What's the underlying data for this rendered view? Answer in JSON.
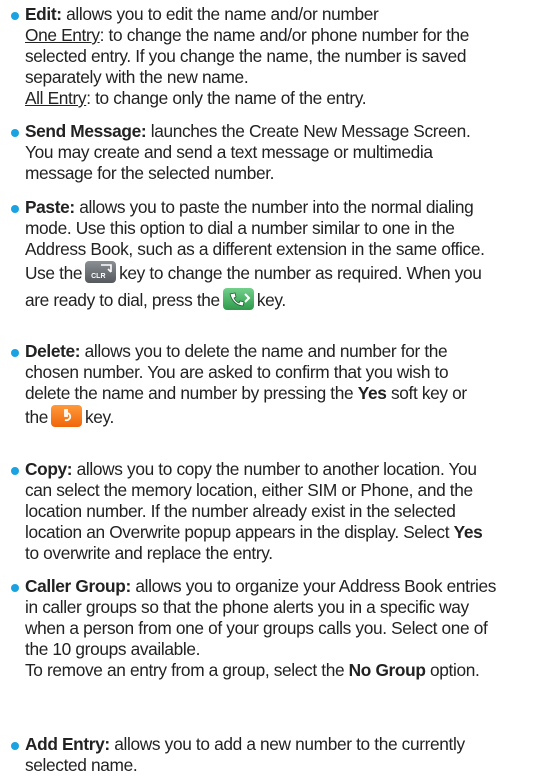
{
  "items": [
    {
      "title": "Edit:",
      "lines": [
        "allows you to edit the name and/or number",
        [
          "One Entry",
          ": to change the name and/or phone number for the"
        ],
        "selected entry. If you change the name, the number is saved",
        "separately with the new name.",
        [
          "All Entry",
          ": to change only the name of the entry."
        ]
      ]
    },
    {
      "title": "Send Message:",
      "lines": [
        "launches the Create New Message Screen.",
        "You may create and send a text message or multimedia",
        "message for the selected number."
      ]
    },
    {
      "title": "Paste:",
      "lines": [
        "allows you to paste the number into the normal dialing",
        "mode. Use this option to dial a number similar to one in the",
        "Address Book, such as a different extension in the same office.",
        [
          "Use the",
          "key to change the number as required. When you"
        ],
        [
          "are ready to dial, press the",
          "key."
        ]
      ]
    },
    {
      "title": "Delete:",
      "lines": [
        "allows you to delete the name and number for the",
        "chosen number. You are asked to confirm that you wish to",
        [
          "delete the name and number by pressing the",
          "Yes",
          "soft key or"
        ],
        [
          "the",
          "key."
        ]
      ]
    },
    {
      "title": "Copy:",
      "lines": [
        "allows you to copy the number to another location. You",
        "can select the memory location, either SIM or Phone, and the",
        "location number. If the number already exist in the selected",
        [
          "location an Overwrite popup appears in the display. Select",
          "Yes"
        ],
        "to overwrite and replace the entry."
      ]
    },
    {
      "title": "Caller Group:",
      "lines": [
        "allows you to organize your Address Book entries",
        "in caller groups so that the phone alerts you in a specific way",
        "when a person from one of your groups calls you. Select one of",
        "the 10 groups available.",
        [
          "To remove an entry from a group, select the",
          "No Group",
          "option."
        ]
      ]
    },
    {
      "title": "Add Entry:",
      "lines": [
        "allows you to add a new number to the currently",
        "selected name."
      ]
    }
  ],
  "keys": {
    "clear_label": "CLR"
  },
  "colors": {
    "bullet": "#1aa3e0",
    "clear_key": "#6d7277",
    "send_key": "#3fae5c",
    "end_key": "#f57a1c"
  }
}
